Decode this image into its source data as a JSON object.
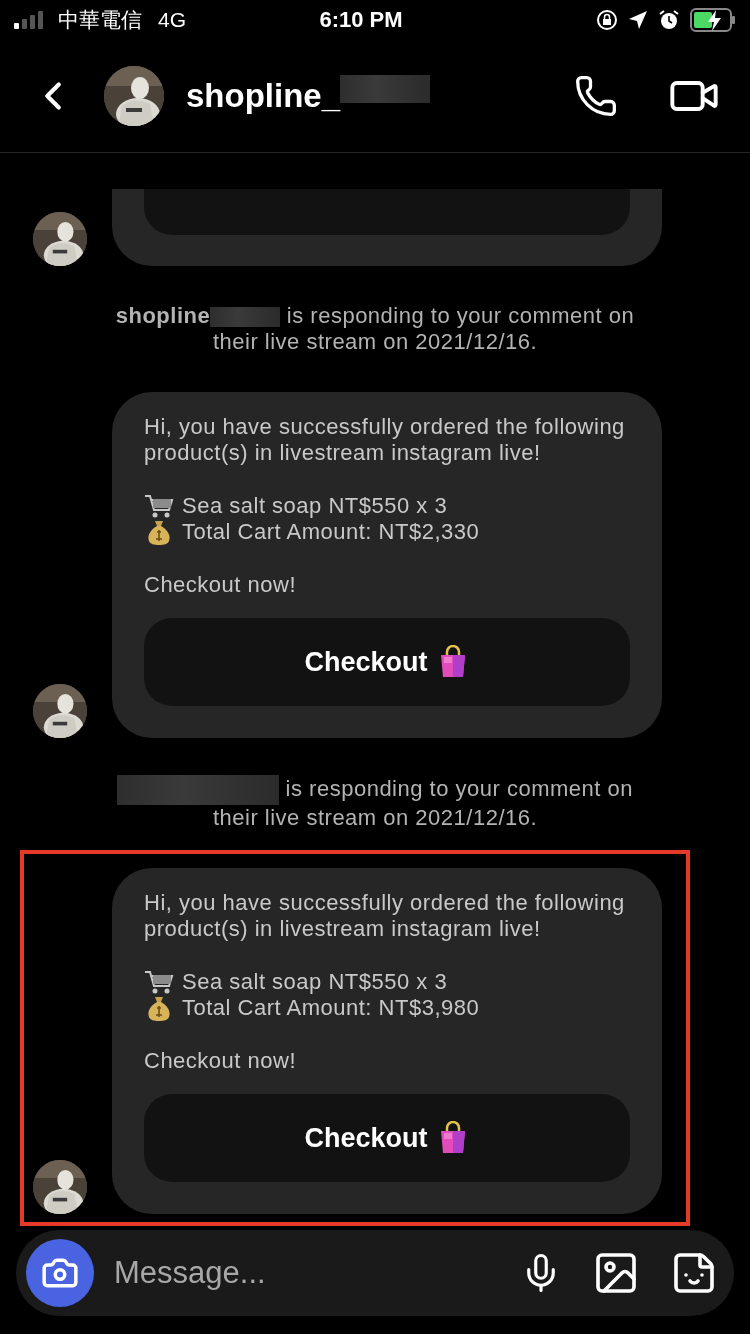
{
  "status_bar": {
    "carrier": "中華電信",
    "network": "4G",
    "time": "6:10 PM"
  },
  "header": {
    "username": "shopline_",
    "redacted": true
  },
  "messages": [
    {
      "kind": "partial"
    },
    {
      "kind": "notice",
      "name": "shopline",
      "redacted": true,
      "text": "is responding to your comment on their live stream on 2021/12/16."
    },
    {
      "kind": "bubble",
      "highlighted": false,
      "intro": "Hi, you have successfully ordered the following product(s) in livestream instagram live!",
      "items": [
        {
          "kind": "cart",
          "text": "Sea salt soap NT$550 x 3"
        },
        {
          "kind": "money_bag",
          "text": "Total Cart Amount: NT$2,330"
        }
      ],
      "footer": "Checkout now!",
      "button": "Checkout"
    },
    {
      "kind": "notice",
      "redacted": true,
      "text": "is responding to your comment on their live stream on 2021/12/16."
    },
    {
      "kind": "bubble",
      "highlighted": true,
      "intro": "Hi, you have successfully ordered the following product(s) in livestream instagram live!",
      "items": [
        {
          "kind": "cart",
          "text": "Sea salt soap NT$550 x 3"
        },
        {
          "kind": "money_bag",
          "text": "Total Cart Amount: NT$3,980"
        }
      ],
      "footer": "Checkout now!",
      "button": "Checkout"
    }
  ],
  "composer": {
    "placeholder": "Message..."
  }
}
